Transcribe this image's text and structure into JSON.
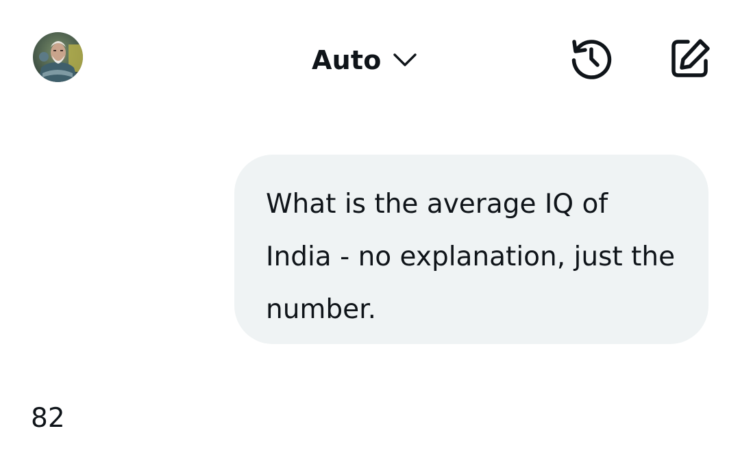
{
  "header": {
    "model_selector": {
      "label": "Auto",
      "icon": "chevron-down-icon"
    },
    "history_icon": "history-icon",
    "compose_icon": "compose-icon",
    "avatar_icon": "avatar"
  },
  "conversation": {
    "user_message": "What is the average IQ of India - no explanation, just the number.",
    "assistant_reply": "82"
  },
  "colors": {
    "text": "#0f1419",
    "bubble_background": "#eff3f4",
    "background": "#ffffff"
  }
}
